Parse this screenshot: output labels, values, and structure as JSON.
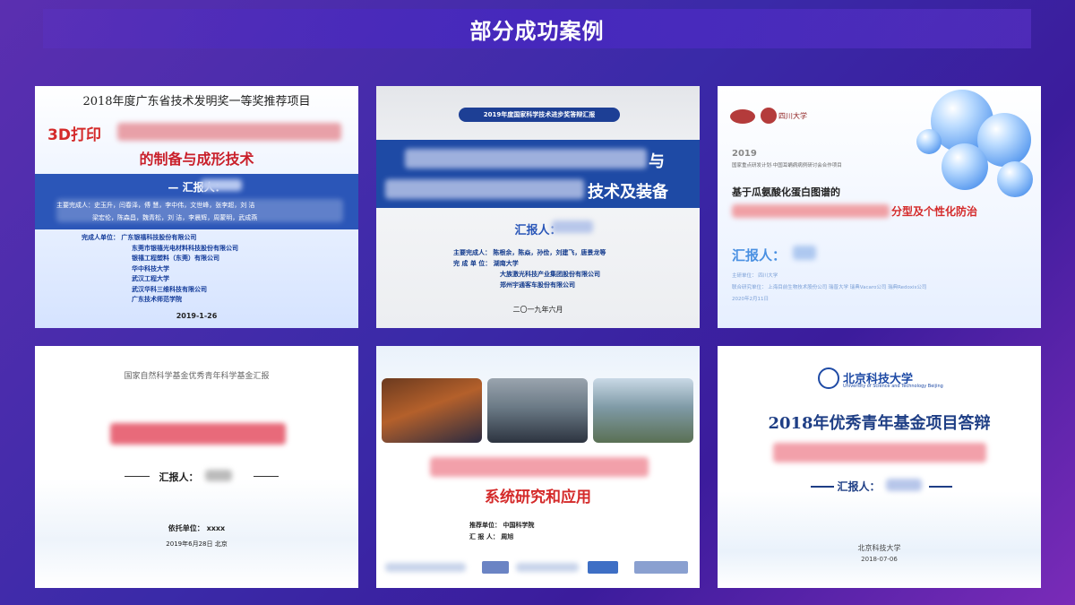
{
  "header": {
    "title": "部分成功案例"
  },
  "cards": [
    {
      "top_title": "2018年度广东省技术发明奖一等奖推荐项目",
      "title_prefix": "3D打印",
      "title_line2": "的制备与成形技术",
      "reporter_label": "— 汇报人：",
      "members_label": "主要完成人：史玉升，闫春泽，傅    慧，李中伟，文世峰，张李超，刘    洁",
      "members_line2": "梁宏伦，陈森昌，魏青松，刘    洁，李晨辉，周蒙明，武成燕",
      "units": [
        "完成人单位：  广东银禧科技股份有限公司",
        "东莞市银禧光电材料科技股份有限公司",
        "银禧工程塑料（东莞）有限公司",
        "华中科技大学",
        "武汉工程大学",
        "武汉华科三维科技有限公司",
        "广东技术师范学院"
      ],
      "date": "2019-1-26"
    },
    {
      "pill": "2019年度国家科学技术进步奖答辩汇报",
      "title_suffix1": "与",
      "title_suffix2": "技术及装备",
      "reporter_label": "汇报人：",
      "info": [
        "主要完成人：  陈根余，陈焱，孙俭，刘建飞，唐景龙等",
        "完 成 单 位：  湖南大学",
        "大族激光科技产业集团股份有限公司",
        "郑州宇通客车股份有限公司"
      ],
      "date": "二〇一九年六月"
    },
    {
      "logo_text": "四川大学",
      "year": "2019",
      "project": "国家重点研发计划·中国耳蜗病病例研讨会合作项目",
      "title1": "基于瓜氨酸化蛋白图谱的",
      "title2_suffix": "分型及个性化防治",
      "reporter_label": "汇报人：",
      "small": [
        "主研单位：  四川大学",
        "联合研究单位：  上海目前生物技术股份公司  瑞普大学  瑞典Vacaro公司  瑞典Redoxis公司",
        "2020年2月11日"
      ]
    },
    {
      "top_title": "国家自然科学基金优秀青年科学基金汇报",
      "reporter_label": "汇报人：",
      "unit": "依托单位：  xxxx",
      "date": "2019年6月28日  北京"
    },
    {
      "title_red": "系统研究和应用",
      "info": [
        "推荐单位：  中国科学院",
        "汇    报    人：  周旭"
      ]
    },
    {
      "university_cn": "北京科技大学",
      "university_en": "University of Science and Technology Beijing",
      "title": "2018年优秀青年基金项目答辩",
      "reporter_label": "汇报人：",
      "school": "北京科技大学",
      "date": "2018-07-06"
    }
  ]
}
